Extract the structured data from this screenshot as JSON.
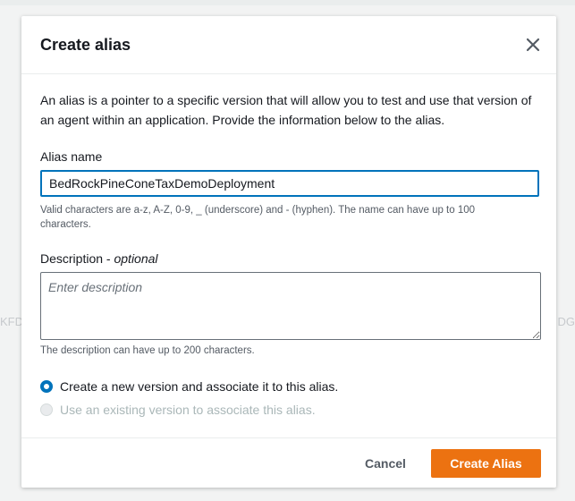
{
  "background": {
    "left_text": "KFD",
    "right_text": "DG"
  },
  "modal": {
    "title": "Create alias",
    "intro": "An alias is a pointer to a specific version that will allow you to test and use that version of an agent within an application. Provide the information below to the alias.",
    "alias_name": {
      "label": "Alias name",
      "value": "BedRockPineConeTaxDemoDeployment",
      "hint": "Valid characters are a-z, A-Z, 0-9, _ (underscore) and - (hyphen). The name can have up to 100 characters."
    },
    "description": {
      "label": "Description",
      "optional": "optional",
      "placeholder": "Enter description",
      "hint": "The description can have up to 200 characters."
    },
    "options": {
      "new_version": "Create a new version and associate it to this alias.",
      "existing_version": "Use an existing version to associate this alias."
    },
    "footer": {
      "cancel_label": "Cancel",
      "submit_label": "Create Alias"
    }
  },
  "colors": {
    "accent": "#0073bb",
    "primary_button": "#ec7211",
    "disabled_text": "#aab7b8"
  },
  "icons": {
    "close": "close-icon"
  }
}
